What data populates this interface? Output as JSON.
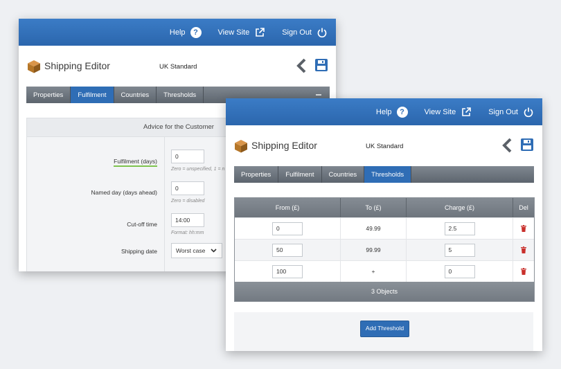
{
  "colors": {
    "topbar": "#2f6db5",
    "active_tab": "#2f6db5",
    "tabbar": "#6e757d",
    "delete": "#c9302c",
    "highlight": "#7ec34e",
    "logo": "#b57628"
  },
  "topbar": {
    "help": "Help",
    "help_glyph": "?",
    "view_site": "View Site",
    "sign_out": "Sign Out",
    "icons": [
      "question-circle-icon",
      "external-link-icon",
      "power-icon"
    ]
  },
  "header": {
    "app_title": "Shipping Editor",
    "doc_title": "UK Standard",
    "icons": [
      "box-logo-icon",
      "back-arrow-icon",
      "save-floppy-icon"
    ]
  },
  "tabs": [
    "Properties",
    "Fulfilment",
    "Countries",
    "Thresholds"
  ],
  "back_window": {
    "active_tab": "Fulfilment",
    "panel_title": "Advice for the Customer",
    "fields": [
      {
        "label": "Fulfilment (days)",
        "value": "0",
        "hint": "Zero = unspecified, 1 = n"
      },
      {
        "label": "Named day (days ahead)",
        "value": "0",
        "hint": "Zero = disabled"
      },
      {
        "label": "Cut-off time",
        "value": "14:00",
        "hint": "Format: hh:mm"
      },
      {
        "label": "Shipping date",
        "value": "Worst case",
        "hint": ""
      }
    ]
  },
  "front_window": {
    "active_tab": "Thresholds",
    "table": {
      "headers": [
        "From (£)",
        "To (£)",
        "Charge (£)",
        "Del"
      ],
      "rows": [
        {
          "from": "0",
          "to": "49.99",
          "charge": "2.5"
        },
        {
          "from": "50",
          "to": "99.99",
          "charge": "5"
        },
        {
          "from": "100",
          "to": "+",
          "charge": "0"
        }
      ],
      "footer": "3 Objects"
    },
    "add_button": "Add Threshold"
  }
}
